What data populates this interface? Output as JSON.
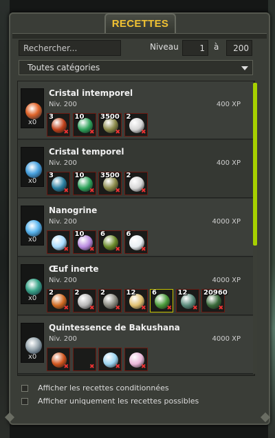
{
  "window": {
    "title": "RECETTES"
  },
  "filters": {
    "search_placeholder": "Rechercher...",
    "level_label": "Niveau",
    "level_min": "1",
    "range_separator": "à",
    "level_max": "200",
    "category": "Toutes catégories"
  },
  "recipes": [
    {
      "name": "Cristal intemporel",
      "level": "Niv. 200",
      "xp": "400 XP",
      "count": "x0",
      "icon": "crystal-orange-icon",
      "icon_color": "#e0642a",
      "ingredients": [
        {
          "qty": "3",
          "icon": "fire-swirl-icon",
          "color": "#c0421c"
        },
        {
          "qty": "10",
          "icon": "green-gem-icon",
          "color": "#2ea35b"
        },
        {
          "qty": "3500",
          "icon": "seed-pile-icon",
          "color": "#8a8a4a"
        },
        {
          "qty": "2",
          "icon": "white-stone-icon",
          "color": "#d6d6d6"
        }
      ]
    },
    {
      "name": "Cristal temporel",
      "level": "Niv. 200",
      "xp": "400 XP",
      "count": "x0",
      "icon": "crystal-blue-icon",
      "icon_color": "#4aa3e0",
      "ingredients": [
        {
          "qty": "3",
          "icon": "blue-swirl-icon",
          "color": "#2a7fa0"
        },
        {
          "qty": "10",
          "icon": "green-gem-icon",
          "color": "#2ea35b"
        },
        {
          "qty": "3500",
          "icon": "seed-pile-icon",
          "color": "#8a8a4a"
        },
        {
          "qty": "2",
          "icon": "white-stone-icon",
          "color": "#d6d6d6"
        }
      ]
    },
    {
      "name": "Nanogrine",
      "level": "Niv. 200",
      "xp": "4000 XP",
      "count": "x0",
      "icon": "orb-blue-icon",
      "icon_color": "#5ab6ef",
      "ingredients": [
        {
          "qty": "",
          "icon": "ice-crystal-icon",
          "color": "#a9dcff"
        },
        {
          "qty": "10",
          "icon": "purple-gem-icon",
          "color": "#b98ae0"
        },
        {
          "qty": "6",
          "icon": "green-block-icon",
          "color": "#6a8a2a"
        },
        {
          "qty": "6",
          "icon": "white-feather-icon",
          "color": "#e8eef2"
        }
      ]
    },
    {
      "name": "Œuf inerte",
      "level": "Niv. 200",
      "xp": "4000 XP",
      "count": "x0",
      "icon": "egg-green-icon",
      "icon_color": "#3aa58a",
      "ingredients": [
        {
          "qty": "2",
          "icon": "orange-shell-icon",
          "color": "#d06a22"
        },
        {
          "qty": "2",
          "icon": "silver-chunk-icon",
          "color": "#b8b8b8"
        },
        {
          "qty": "2",
          "icon": "dark-pile-icon",
          "color": "#8a8a80"
        },
        {
          "qty": "12",
          "icon": "wheat-icon",
          "color": "#e0c070"
        },
        {
          "qty": "6",
          "icon": "leaf-icon",
          "color": "#4a9a3a",
          "highlight": true
        },
        {
          "qty": "12",
          "icon": "creature-icon",
          "color": "#5a8a7a"
        },
        {
          "qty": "20960",
          "icon": "herb-icon",
          "color": "#3a6a3a"
        }
      ]
    },
    {
      "name": "Quintessence de Bakushana",
      "level": "Niv. 200",
      "xp": "4000 XP",
      "count": "x0",
      "icon": "potion-flask-icon",
      "icon_color": "#9aa8b0",
      "ingredients": [
        {
          "qty": "",
          "icon": "orange-swirl-icon",
          "color": "#d0551e"
        },
        {
          "qty": "",
          "icon": "empty-icon",
          "color": "#1a1b19"
        },
        {
          "qty": "",
          "icon": "snow-crystal-icon",
          "color": "#9ad4f0"
        },
        {
          "qty": "",
          "icon": "pink-orb-icon",
          "color": "#e9b6d8"
        }
      ]
    }
  ],
  "options": {
    "conditional": "Afficher les recettes conditionnées",
    "possible": "Afficher uniquement les recettes possibles"
  },
  "colors": {
    "accent_title": "#f1c232",
    "scrollbar": "#a6d000",
    "missing_mark": "#e33333"
  }
}
